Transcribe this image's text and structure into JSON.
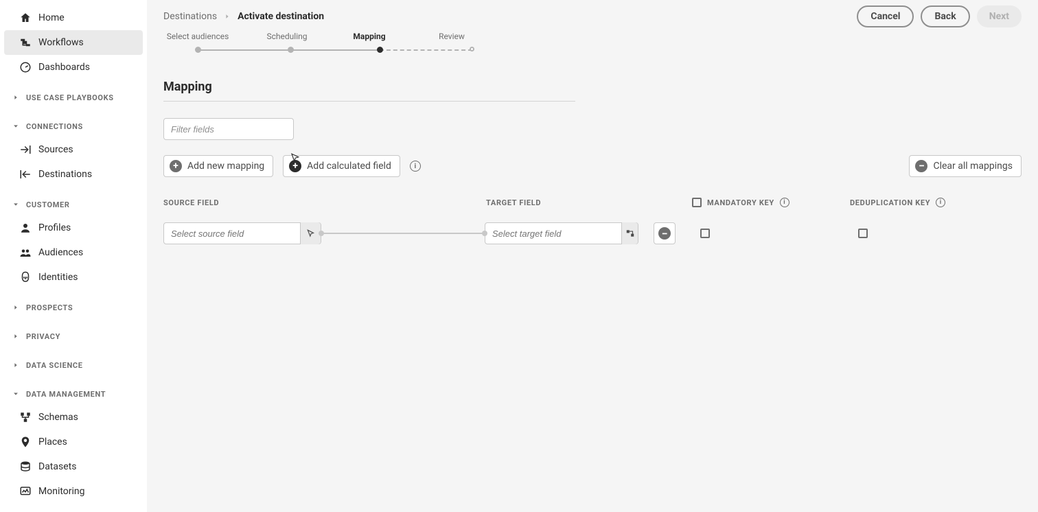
{
  "sidebar": {
    "items_top": [
      {
        "label": "Home",
        "icon": "home"
      },
      {
        "label": "Workflows",
        "icon": "workflow",
        "selected": true
      },
      {
        "label": "Dashboards",
        "icon": "dashboard"
      }
    ],
    "sections": [
      {
        "label": "USE CASE PLAYBOOKS",
        "collapsed": true,
        "items": []
      },
      {
        "label": "CONNECTIONS",
        "collapsed": false,
        "items": [
          {
            "label": "Sources",
            "icon": "sources"
          },
          {
            "label": "Destinations",
            "icon": "destinations"
          }
        ]
      },
      {
        "label": "CUSTOMER",
        "collapsed": false,
        "items": [
          {
            "label": "Profiles",
            "icon": "profile"
          },
          {
            "label": "Audiences",
            "icon": "audiences"
          },
          {
            "label": "Identities",
            "icon": "identities"
          }
        ]
      },
      {
        "label": "PROSPECTS",
        "collapsed": true,
        "items": []
      },
      {
        "label": "PRIVACY",
        "collapsed": true,
        "items": []
      },
      {
        "label": "DATA SCIENCE",
        "collapsed": true,
        "items": []
      },
      {
        "label": "DATA MANAGEMENT",
        "collapsed": false,
        "items": [
          {
            "label": "Schemas",
            "icon": "schemas"
          },
          {
            "label": "Places",
            "icon": "places"
          },
          {
            "label": "Datasets",
            "icon": "datasets"
          },
          {
            "label": "Monitoring",
            "icon": "monitoring"
          }
        ]
      }
    ]
  },
  "header": {
    "breadcrumb_root": "Destinations",
    "breadcrumb_current": "Activate destination",
    "buttons": {
      "cancel": "Cancel",
      "back": "Back",
      "next": "Next"
    }
  },
  "stepper": {
    "steps": [
      "Select audiences",
      "Scheduling",
      "Mapping",
      "Review"
    ],
    "active_index": 2
  },
  "page": {
    "title": "Mapping",
    "filter_placeholder": "Filter fields",
    "add_mapping_label": "Add new mapping",
    "add_calc_label": "Add calculated field",
    "clear_all_label": "Clear all mappings",
    "columns": {
      "source": "SOURCE FIELD",
      "target": "TARGET FIELD",
      "mandatory": "MANDATORY KEY",
      "dedup": "DEDUPLICATION KEY"
    },
    "row": {
      "source_placeholder": "Select source field",
      "target_placeholder": "Select target field"
    }
  }
}
